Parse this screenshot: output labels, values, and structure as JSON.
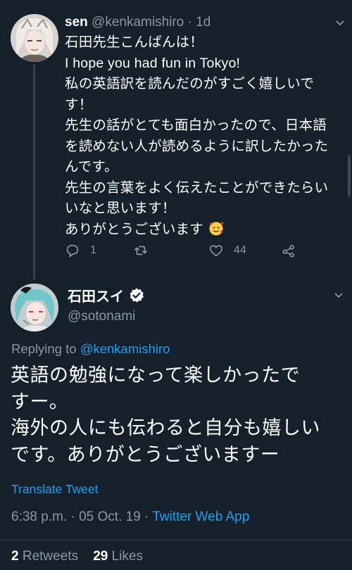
{
  "colors": {
    "background": "#15202b",
    "text": "#ffffff",
    "secondary": "#8899a6",
    "link": "#1da1f2",
    "divider": "#38444d"
  },
  "reply_tweet": {
    "display_name": "sen",
    "handle": "@kenkamishiro",
    "separator": "·",
    "age": "1d",
    "text_lines": [
      "石田先生こんばんは！",
      "I hope you had fun in Tokyo!",
      "私の英語訳を読んだのがすごく嬉しいで",
      "す！",
      "先生の話がとても面白かったので、日本語",
      "を読めない人が読めるように訳したかった",
      "んです。",
      "先生の言葉をよく伝えたことができたらい",
      "いなと思います！",
      "ありがとうございます"
    ],
    "emoji": "smiling-face-with-hearts-icon",
    "actions": {
      "reply_count": "1",
      "retweet_count": "",
      "like_count": "44"
    }
  },
  "main_tweet": {
    "display_name": "石田スイ",
    "handle": "@sotonami",
    "replying_prefix": "Replying to ",
    "replying_to": "@kenkamishiro",
    "text_lines": [
      "英語の勉強になって楽しかったで",
      "すー。",
      "海外の人にも伝わると自分も嬉しい",
      "です。ありがとうございますー"
    ],
    "translate_label": "Translate Tweet",
    "timestamp": "6:38 p.m. · 05 Oct. 19 · ",
    "source": "Twitter Web App",
    "retweets_count": "2",
    "retweets_label": " Retweets",
    "likes_count": "29",
    "likes_label": " Likes"
  }
}
